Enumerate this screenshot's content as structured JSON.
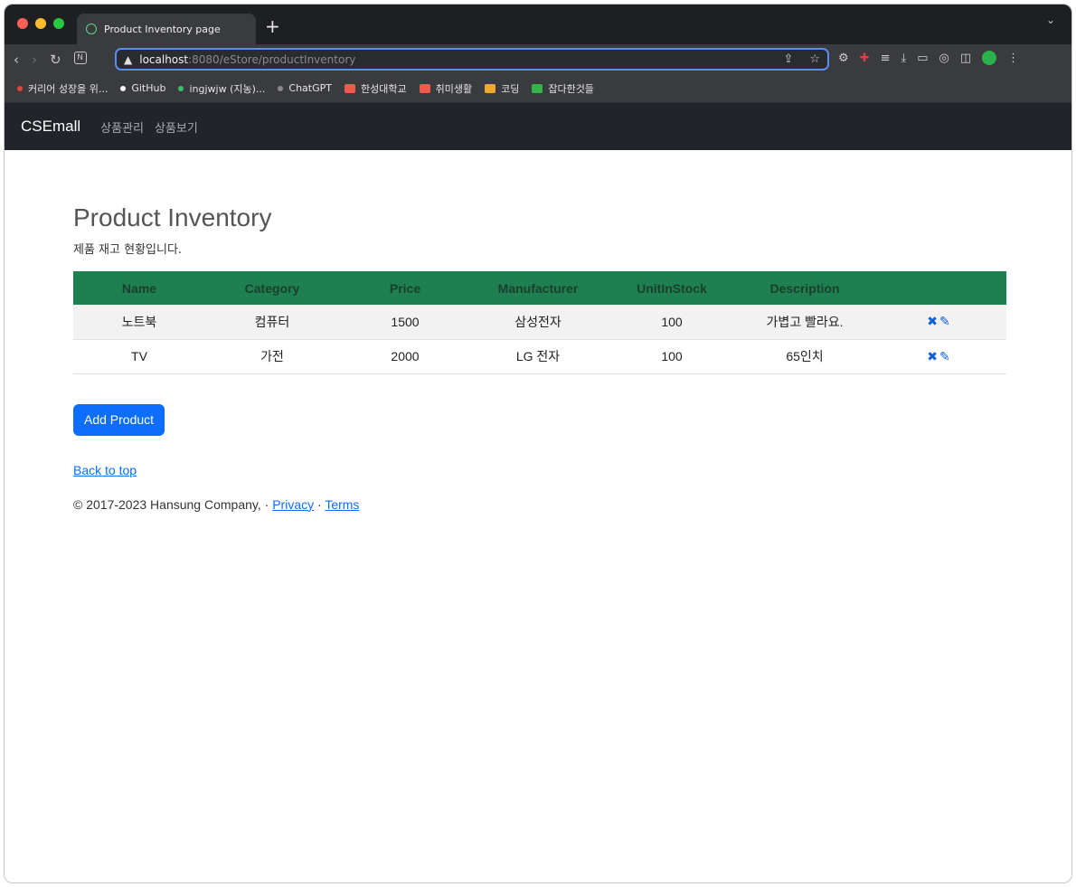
{
  "browser": {
    "tab_title": "Product Inventory page",
    "new_tab": "+",
    "url_host": "localhost",
    "url_path": ":8080/eStore/productInventory",
    "bookmarks": [
      {
        "label": "커리어 성장을 위...",
        "color": "#e94040",
        "kind": "dot"
      },
      {
        "label": "GitHub",
        "color": "#ffffff",
        "kind": "dot"
      },
      {
        "label": "ingjwjw (지농)...",
        "color": "#3bbf6e",
        "kind": "dot"
      },
      {
        "label": "ChatGPT",
        "color": "#8a8a8a",
        "kind": "dot"
      },
      {
        "label": "한성대학교",
        "color": "#f05a4a",
        "kind": "folder"
      },
      {
        "label": "취미생활",
        "color": "#f05a4a",
        "kind": "folder"
      },
      {
        "label": "코딩",
        "color": "#f0a92e",
        "kind": "folder"
      },
      {
        "label": "잡다한것들",
        "color": "#35b34a",
        "kind": "folder"
      }
    ]
  },
  "navbar": {
    "brand": "CSEmall",
    "links": [
      "상품관리",
      "상품보기"
    ]
  },
  "page": {
    "title": "Product Inventory",
    "subtitle": "제품 재고 현황입니다."
  },
  "table": {
    "headers": [
      "Name",
      "Category",
      "Price",
      "Manufacturer",
      "UnitInStock",
      "Description",
      ""
    ],
    "rows": [
      [
        "노트북",
        "컴퓨터",
        "1500",
        "삼성전자",
        "100",
        "가볍고 빨라요."
      ],
      [
        "TV",
        "가전",
        "2000",
        "LG 전자",
        "100",
        "65인치"
      ]
    ]
  },
  "actions": {
    "add_product": "Add Product",
    "back_to_top": "Back to top"
  },
  "footer": {
    "copyright": "© 2017-2023 Hansung Company,",
    "sep1": " · ",
    "privacy": "Privacy",
    "sep2": " · ",
    "terms": "Terms"
  },
  "colors": {
    "table_header": "#1e8050",
    "navbar": "#212529",
    "primary": "#0d6efd"
  }
}
